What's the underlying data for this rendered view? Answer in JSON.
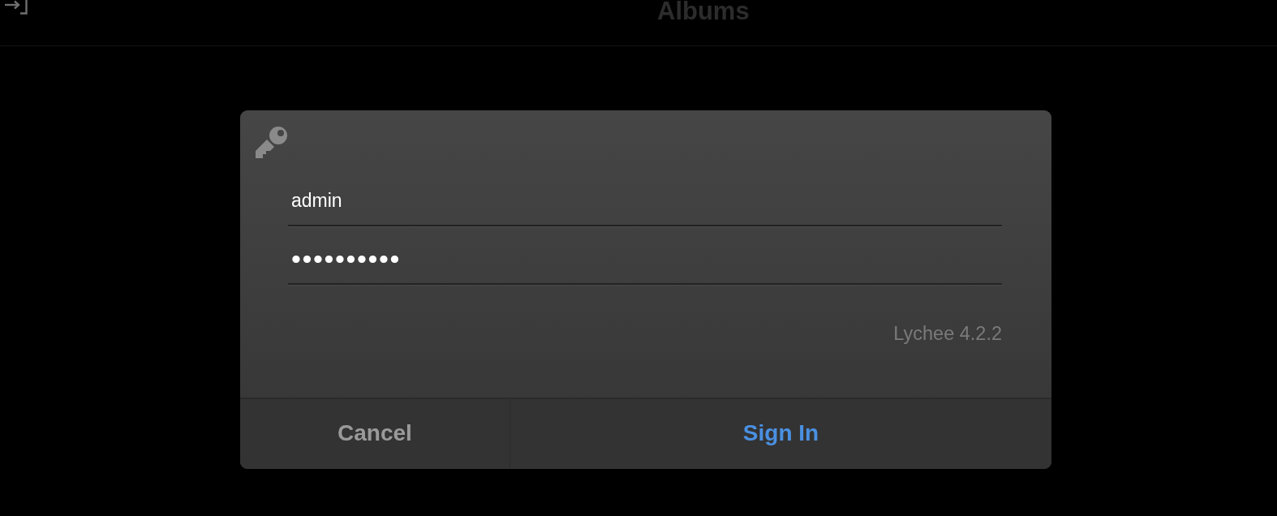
{
  "header": {
    "title": "Albums"
  },
  "dialog": {
    "fields": [
      {
        "kind": "text",
        "value": "admin"
      },
      {
        "kind": "password",
        "value": "••••••••••"
      }
    ],
    "version": "Lychee 4.2.2",
    "buttons": [
      {
        "kind": "cancel",
        "label": "Cancel"
      },
      {
        "kind": "primary",
        "label": "Sign In"
      }
    ]
  }
}
